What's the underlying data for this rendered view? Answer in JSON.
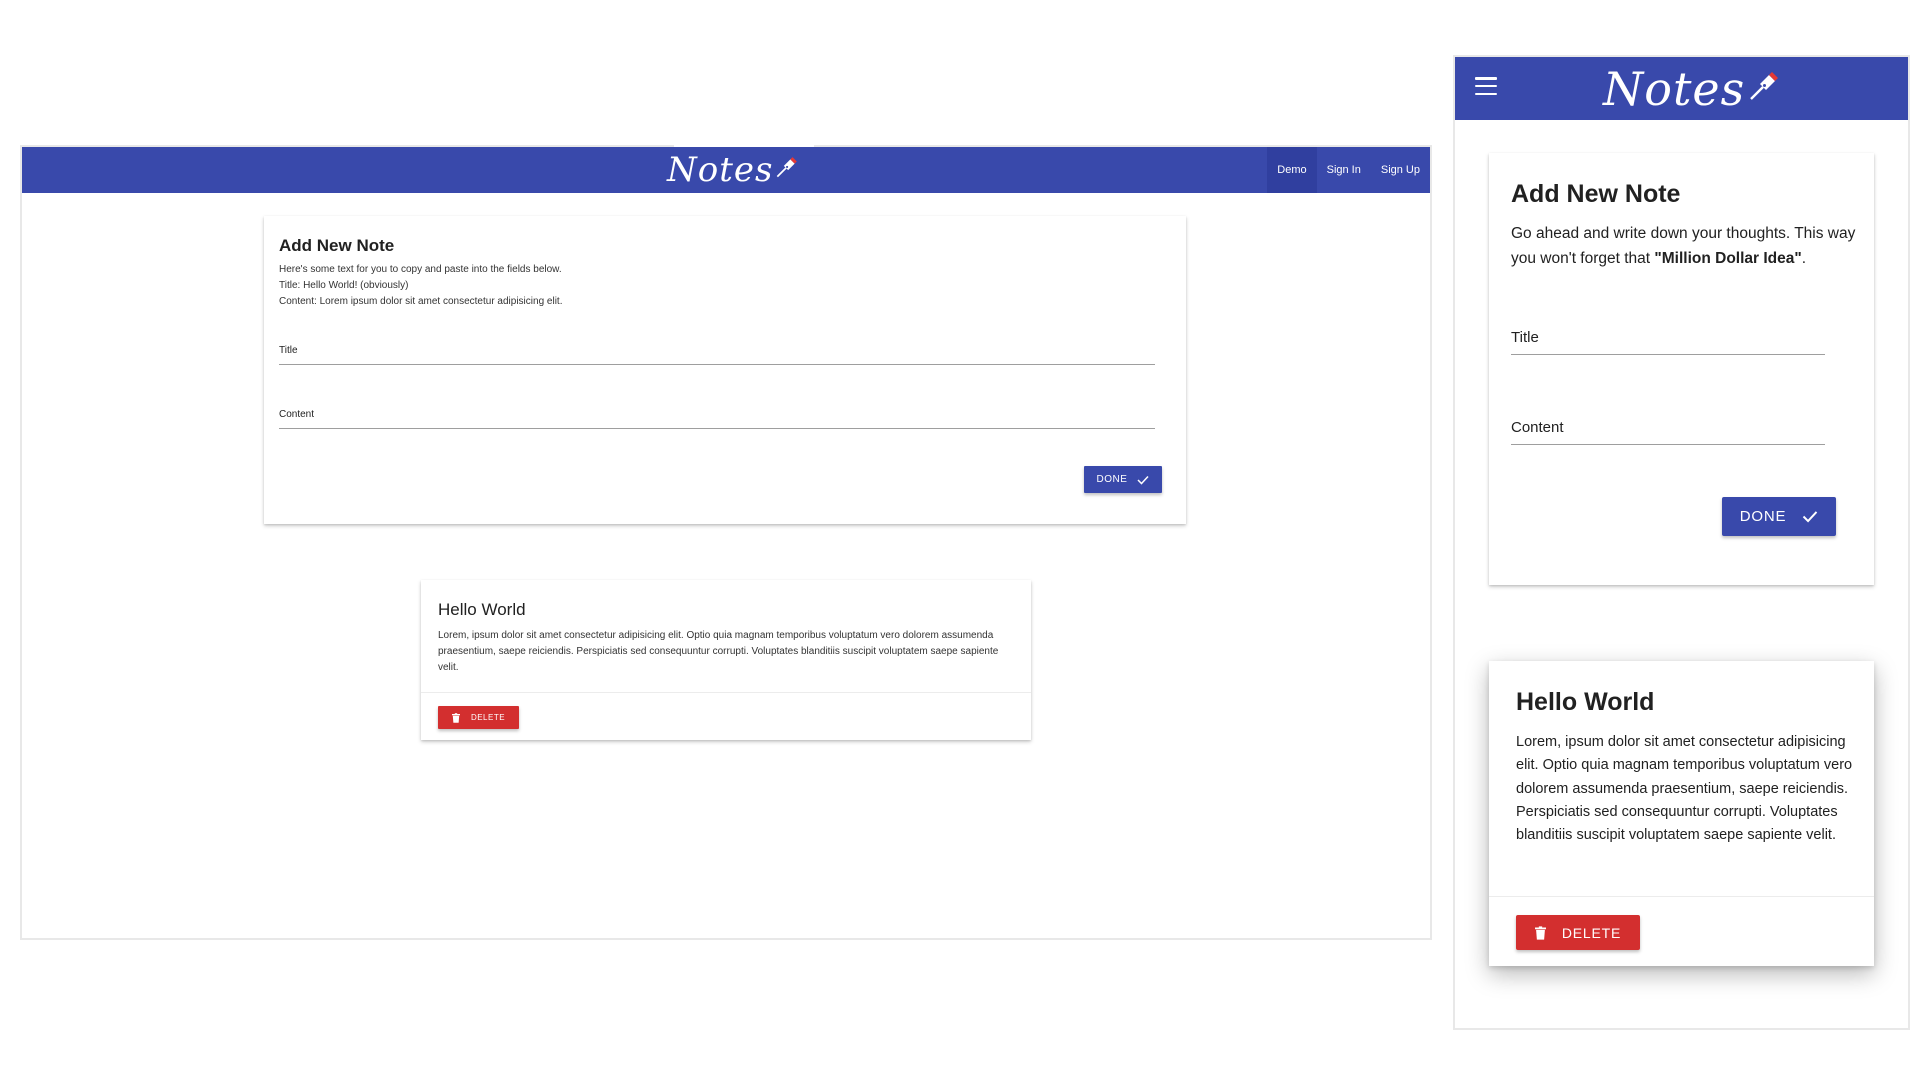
{
  "app": {
    "logo_text": "Notes"
  },
  "desktop": {
    "nav": {
      "links": [
        {
          "label": "Demo",
          "active": true
        },
        {
          "label": "Sign In",
          "active": false
        },
        {
          "label": "Sign Up",
          "active": false
        }
      ]
    },
    "add_note": {
      "title": "Add New Note",
      "instructions": [
        "Here's some text for you to copy and paste into the fields below.",
        "Title: Hello World! (obviously)",
        "Content: Lorem ipsum dolor sit amet consectetur adipisicing elit."
      ],
      "title_field": {
        "label": "Title",
        "value": ""
      },
      "content_field": {
        "label": "Content",
        "value": ""
      },
      "done_label": "Done"
    },
    "note": {
      "title": "Hello World",
      "body": "Lorem, ipsum dolor sit amet consectetur adipisicing elit. Optio quia magnam temporibus voluptatum vero dolorem assumenda praesentium, saepe reiciendis. Perspiciatis sed consequuntur corrupti. Voluptates blanditiis suscipit voluptatem saepe sapiente velit.",
      "delete_label": "Delete"
    }
  },
  "mobile": {
    "add_note": {
      "title": "Add New Note",
      "desc_before": "Go ahead and write down your thoughts. This way you won't forget that ",
      "desc_bold": "\"Million Dollar Idea\"",
      "desc_after": ".",
      "title_field": {
        "label": "Title",
        "value": ""
      },
      "content_field": {
        "label": "Content",
        "value": ""
      },
      "done_label": "Done"
    },
    "note": {
      "title": "Hello World",
      "body": "Lorem, ipsum dolor sit amet consectetur adipisicing elit. Optio quia magnam temporibus voluptatum vero dolorem assumenda praesentium, saepe reiciendis. Perspiciatis sed consequuntur corrupti. Voluptates blanditiis suscipit voluptatem saepe sapiente velit.",
      "delete_label": "Delete"
    }
  },
  "icons": {
    "menu": "hamburger-menu-icon",
    "done": "checkmark-icon",
    "delete": "trash-icon",
    "logo_pen": "pen-nib-icon"
  },
  "colors": {
    "primary": "#3949ab",
    "primary_dark": "#303f9f",
    "danger": "#d32f2f",
    "pen_tip": "#e53935"
  }
}
